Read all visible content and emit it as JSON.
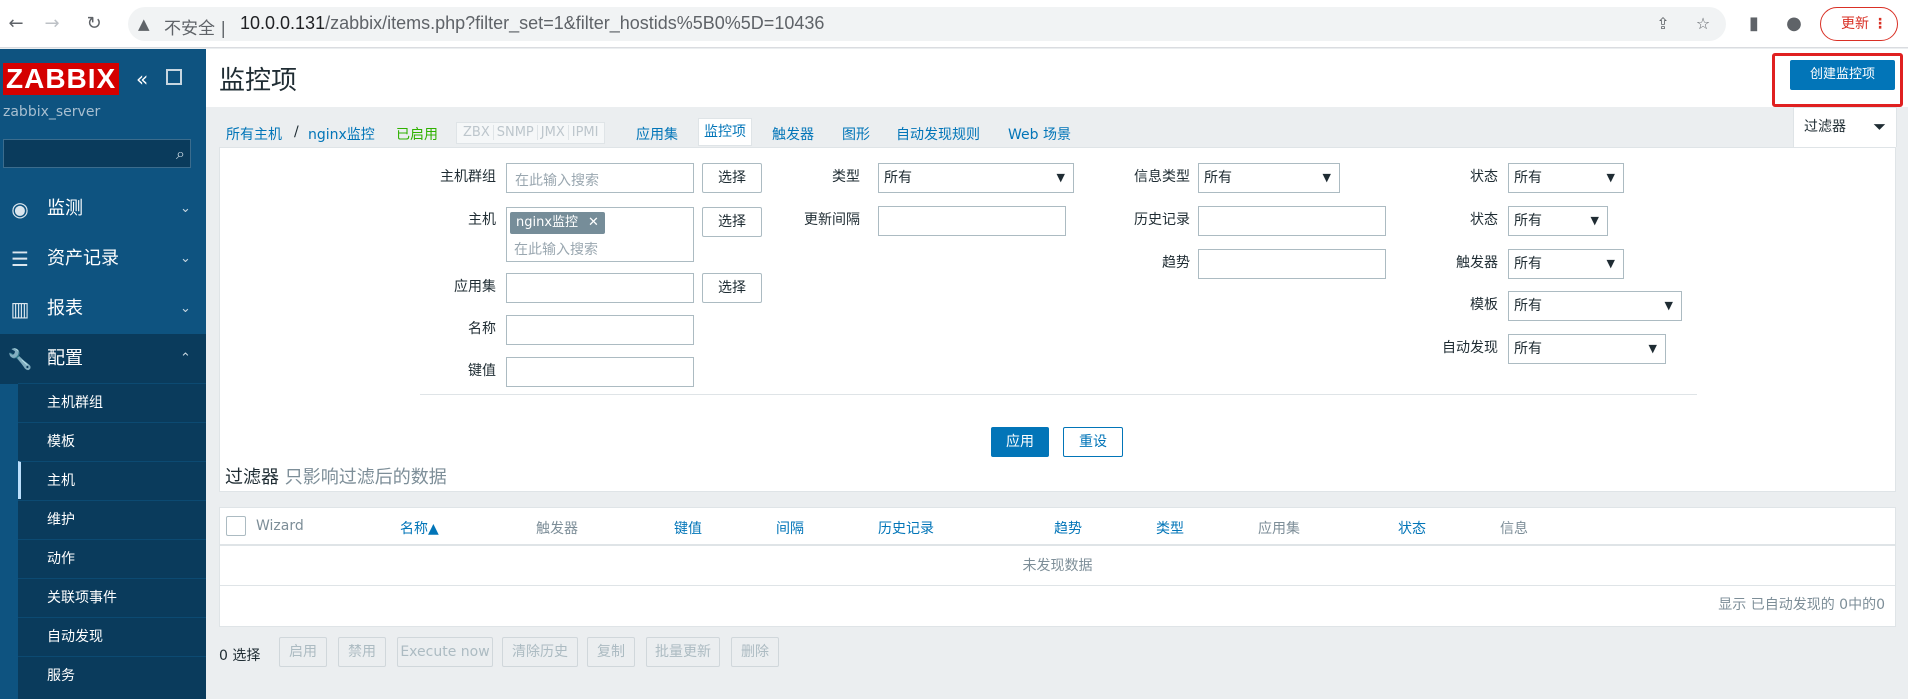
{
  "browser": {
    "insecure_label": "不安全 |",
    "url_host": "10.0.0.131",
    "url_path": "/zabbix/items.php?filter_set=1&filter_hostids%5B0%5D=10436",
    "update_label": "更新"
  },
  "sidebar": {
    "logo": "ZABBIX",
    "server_name": "zabbix_server",
    "menu": [
      {
        "label": "监测"
      },
      {
        "label": "资产记录"
      },
      {
        "label": "报表"
      },
      {
        "label": "配置"
      }
    ],
    "submenu": [
      {
        "label": "主机群组"
      },
      {
        "label": "模板"
      },
      {
        "label": "主机"
      },
      {
        "label": "维护"
      },
      {
        "label": "动作"
      },
      {
        "label": "关联项事件"
      },
      {
        "label": "自动发现"
      },
      {
        "label": "服务"
      }
    ]
  },
  "header": {
    "title": "监控项",
    "create_button": "创建监控项"
  },
  "breadcrumbs": {
    "all_hosts": "所有主机",
    "separator": "/",
    "host": "nginx监控",
    "enabled": "已启用",
    "availability": [
      "ZBX",
      "SNMP",
      "JMX",
      "IPMI"
    ],
    "apps": "应用集",
    "items": "监控项",
    "triggers": "触发器",
    "graphs": "图形",
    "discovery": "自动发现规则",
    "web": "Web 场景"
  },
  "filter": {
    "tab_label": "过滤器",
    "host_group_label": "主机群组",
    "host_label": "主机",
    "app_label": "应用集",
    "name_label": "名称",
    "key_label": "键值",
    "search_placeholder": "在此输入搜索",
    "select_button": "选择",
    "host_tag": "nginx监控",
    "type_label": "类型",
    "type_value": "所有",
    "interval_label": "更新间隔",
    "info_type_label": "信息类型",
    "info_type_value": "所有",
    "history_label": "历史记录",
    "trends_label": "趋势",
    "state_label": "状态",
    "state_value": "所有",
    "status_label": "状态",
    "status_value": "所有",
    "triggers_label": "触发器",
    "triggers_value": "所有",
    "template_label": "模板",
    "template_value": "所有",
    "discovery_label": "自动发现",
    "discovery_value": "所有",
    "apply_button": "应用",
    "reset_button": "重设",
    "note_title": "过滤器",
    "note_sub": "只影响过滤后的数据"
  },
  "table": {
    "columns": [
      "Wizard",
      "名称▲",
      "触发器",
      "键值",
      "间隔",
      "历史记录",
      "趋势",
      "类型",
      "应用集",
      "状态",
      "信息"
    ],
    "empty_text": "未发现数据",
    "footer": "显示 已自动发现的 0中的0"
  },
  "actions": {
    "selected": "0 选择",
    "buttons": [
      "启用",
      "禁用",
      "Execute now",
      "清除历史",
      "复制",
      "批量更新",
      "删除"
    ]
  }
}
